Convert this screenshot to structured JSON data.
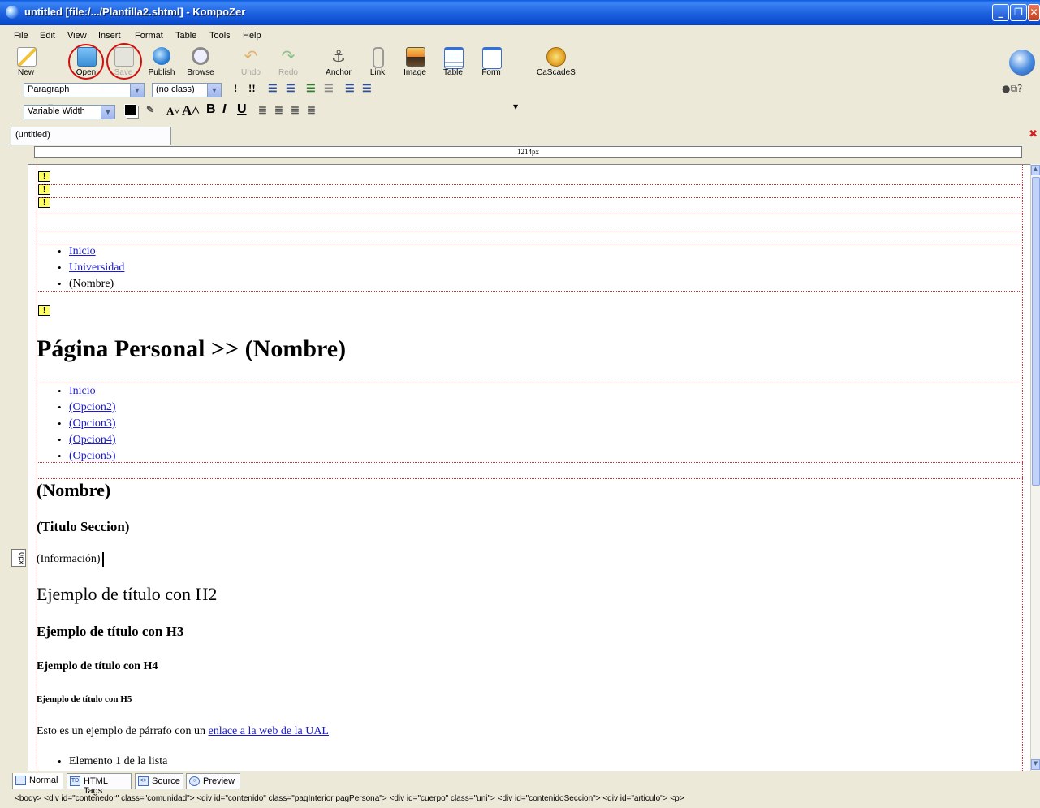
{
  "window": {
    "title": "untitled [file:/.../Plantilla2.shtml] - KompoZer",
    "controls": {
      "minimize": "_",
      "maximize": "❐",
      "close": "✕"
    }
  },
  "menu": [
    "File",
    "Edit",
    "View",
    "Insert",
    "Format",
    "Table",
    "Tools",
    "Help"
  ],
  "toolbar": {
    "buttons": [
      {
        "label": "New",
        "icon": "new-page-icon",
        "enabled": true
      },
      {
        "label": "Open",
        "icon": "open-folder-icon",
        "enabled": true
      },
      {
        "label": "Save",
        "icon": "save-disk-icon",
        "enabled": false
      },
      {
        "label": "Publish",
        "icon": "publish-globe-icon",
        "enabled": true
      },
      {
        "label": "Browse",
        "icon": "browse-magnifier-icon",
        "enabled": true
      },
      {
        "label": "Undo",
        "icon": "undo-arrow-icon",
        "enabled": false
      },
      {
        "label": "Redo",
        "icon": "redo-arrow-icon",
        "enabled": false
      },
      {
        "label": "Anchor",
        "icon": "anchor-icon",
        "enabled": true
      },
      {
        "label": "Link",
        "icon": "link-chain-icon",
        "enabled": true
      },
      {
        "label": "Image",
        "icon": "image-icon",
        "enabled": true
      },
      {
        "label": "Table",
        "icon": "table-icon",
        "enabled": true
      },
      {
        "label": "Form",
        "icon": "form-icon",
        "enabled": true
      },
      {
        "label": "CaScadeS",
        "icon": "css-editor-icon",
        "enabled": true
      }
    ]
  },
  "format1": {
    "paragraph_select": "Paragraph",
    "class_select": "(no class)"
  },
  "format2": {
    "font_select": "Variable Width",
    "bold": "B",
    "italic": "I",
    "underline": "U"
  },
  "tabs": {
    "active": "(untitled)"
  },
  "ruler": {
    "width_label": "1214px",
    "left_label": "0px"
  },
  "document": {
    "breadcrumb_links": [
      "Inicio",
      "Universidad"
    ],
    "breadcrumb_current": "(Nombre)",
    "page_heading": "Página Personal >> (Nombre)",
    "nav_links": [
      "Inicio",
      "(Opcion2)",
      "(Opcion3)",
      "(Opcion4)",
      "(Opcion5)"
    ],
    "name_heading": "(Nombre)",
    "section_title": "(Titulo Seccion)",
    "info_text": "(Información)",
    "h2_example": "Ejemplo de título con H2",
    "h3_example": "Ejemplo de título con H3",
    "h4_example": "Ejemplo de título con H4",
    "h5_example": "Ejemplo de título con H5",
    "paragraph_prefix": "Esto es un ejemplo de párrafo con un ",
    "paragraph_link": "enlace a la web de la UAL",
    "list_item_1": "Elemento 1 de la lista"
  },
  "modes": [
    "Normal",
    "HTML Tags",
    "Source",
    "Preview"
  ],
  "status": {
    "path": "<body> <div id=\"contenedor\" class=\"comunidad\"> <div id=\"contenido\" class=\"pagInterior pagPersona\"> <div id=\"cuerpo\" class=\"uni\"> <div id=\"contenidoSeccion\"> <div id=\"articulo\"> <p>"
  },
  "colors": {
    "link": "#1a1acc",
    "dotted_border": "#d03030",
    "annotation_circle": "#d01010",
    "titlebar": "#1f63e0"
  }
}
